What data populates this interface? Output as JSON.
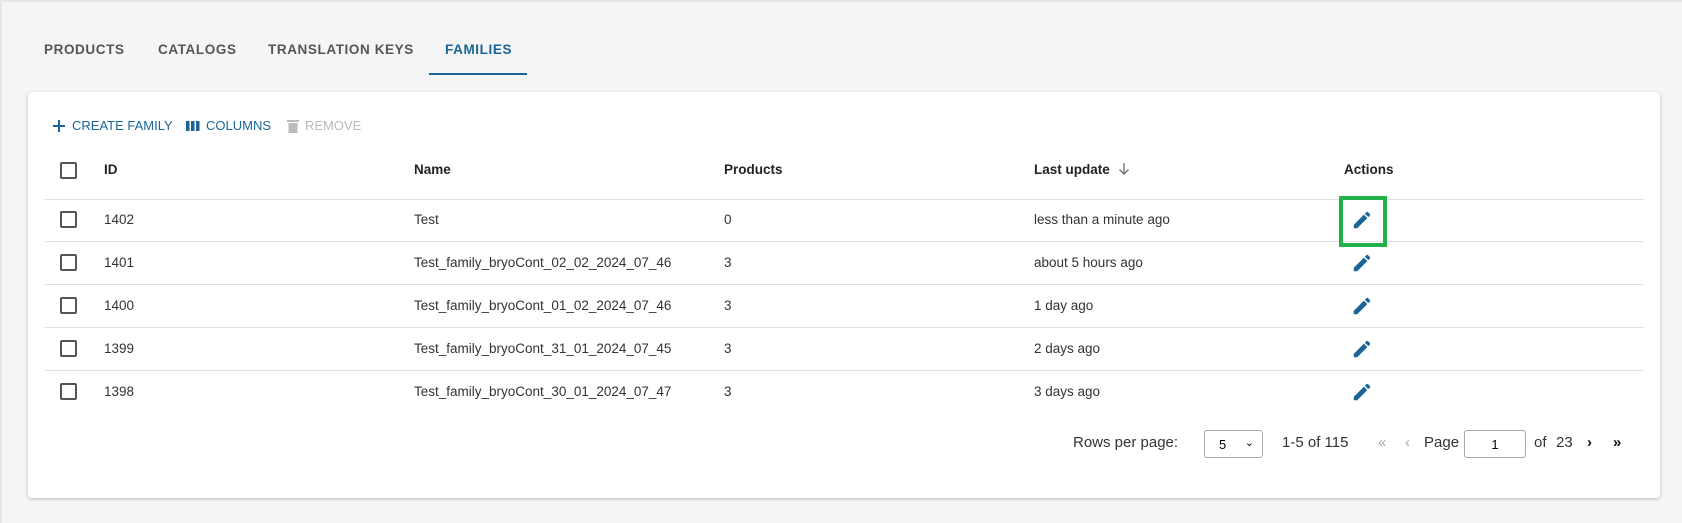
{
  "tabs": [
    {
      "label": "PRODUCTS"
    },
    {
      "label": "CATALOGS"
    },
    {
      "label": "TRANSLATION KEYS"
    },
    {
      "label": "FAMILIES",
      "active": true
    }
  ],
  "toolbar": {
    "create": "CREATE FAMILY",
    "columns": "COLUMNS",
    "remove": "REMOVE"
  },
  "table": {
    "headers": {
      "id": "ID",
      "name": "Name",
      "products": "Products",
      "last_update": "Last update",
      "actions": "Actions"
    },
    "sort": {
      "column": "Last update",
      "direction": "descending"
    },
    "rows": [
      {
        "id": "1402",
        "name": "Test",
        "products": "0",
        "last_update": "less than a minute ago"
      },
      {
        "id": "1401",
        "name": "Test_family_bryoCont_02_02_2024_07_46",
        "products": "3",
        "last_update": "about 5 hours ago"
      },
      {
        "id": "1400",
        "name": "Test_family_bryoCont_01_02_2024_07_46",
        "products": "3",
        "last_update": "1 day ago"
      },
      {
        "id": "1399",
        "name": "Test_family_bryoCont_31_01_2024_07_45",
        "products": "3",
        "last_update": "2 days ago"
      },
      {
        "id": "1398",
        "name": "Test_family_bryoCont_30_01_2024_07_47",
        "products": "3",
        "last_update": "3 days ago"
      }
    ]
  },
  "pagination": {
    "rows_label": "Rows per page:",
    "rows_value": "5",
    "range": "1-5 of 115",
    "first": "«",
    "prev": "‹",
    "page_label": "Page",
    "page_value": "1",
    "of_label": "of",
    "total_pages": "23",
    "next": "›",
    "last": "»"
  },
  "colors": {
    "accent": "#1a6596",
    "highlight": "#22b04b"
  }
}
